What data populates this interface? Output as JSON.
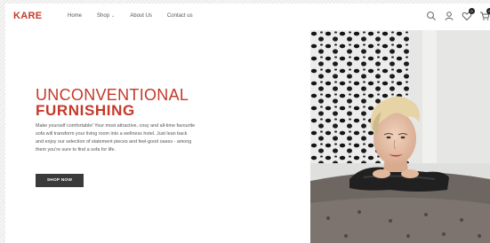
{
  "header": {
    "logo": "KARE",
    "nav": {
      "home": "Home",
      "shop": "Shop",
      "about": "About Us",
      "contact": "Contact us"
    },
    "icons": {
      "search": "search-icon",
      "account": "user-icon",
      "wishlist": "heart-icon",
      "cart": "cart-icon"
    },
    "wishlist_count": "0",
    "cart_count": "0"
  },
  "hero": {
    "title_line1": "UNCONVENTIONAL",
    "title_line2": "FURNISHING",
    "description": "Make yourself comfortable! Your most attractive, cosy and all-time favourite sofa will transform your living room into a wellness hotel. Just lean back and enjoy our selection of statement pieces and feel-good oases - among them you're sure to find a sofa for life.",
    "button_label": "SHOP NOW"
  },
  "colors": {
    "accent": "#c4392a",
    "button_bg": "#3a3a3a"
  }
}
